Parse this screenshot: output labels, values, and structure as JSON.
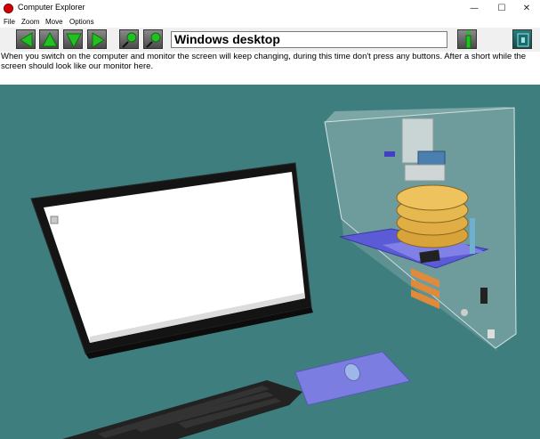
{
  "window": {
    "title": "Computer Explorer",
    "minimize": "—",
    "maximize": "☐",
    "close": "✕"
  },
  "menu": {
    "file": "File",
    "zoom": "Zoom",
    "move": "Move",
    "options": "Options"
  },
  "toolbar": {
    "location_title": "Windows desktop"
  },
  "description": "When you switch on the computer and monitor the screen will keep changing, during this time don't press any buttons. After a short while the screen should look like our monitor here.",
  "colors": {
    "scene_bg": "#3f7e7e",
    "nav_green": "#22c022",
    "title_red": "#d40000"
  },
  "icons": [
    "back-arrow-icon",
    "up-arrow-icon",
    "down-arrow-icon",
    "forward-arrow-icon",
    "zoom-in-icon",
    "zoom-out-icon",
    "info-icon",
    "exit-icon"
  ]
}
